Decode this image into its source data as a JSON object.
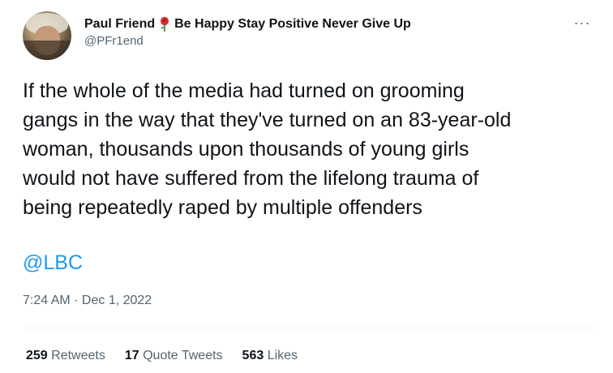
{
  "author": {
    "display_name_part1": "Paul Friend",
    "rose_emoji": "rose-icon",
    "display_name_part2": "Be Happy Stay Positive Never Give Up",
    "handle": "@PFr1end"
  },
  "menu": {
    "more_label": "···"
  },
  "tweet": {
    "text": "If the whole of the media had turned on grooming\ngangs in the way that they've turned on an 83-year-old\nwoman, thousands upon thousands of young girls\nwould not have suffered from the lifelong trauma of\nbeing repeatedly raped by multiple offenders",
    "mention": "@LBC",
    "timestamp": "7:24 AM · Dec 1, 2022"
  },
  "stats": {
    "retweets_count": "259",
    "retweets_label": "Retweets",
    "quotes_count": "17",
    "quotes_label": "Quote Tweets",
    "likes_count": "563",
    "likes_label": "Likes"
  },
  "colors": {
    "text": "#0f1419",
    "secondary": "#536471",
    "link": "#1d9bf0",
    "divider": "#eff3f4"
  }
}
